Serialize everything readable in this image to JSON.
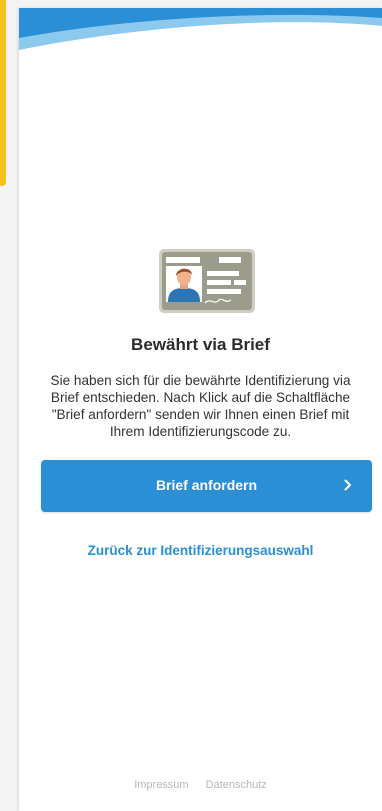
{
  "colors": {
    "accent_yellow": "#f7c21c",
    "brand_blue": "#2b8fd6",
    "background": "#f3f3f3",
    "card": "#ffffff"
  },
  "icons": {
    "header": "wave-header-graphic",
    "illustration": "id-card-icon",
    "button": "chevron-right-icon"
  },
  "main": {
    "title": "Bewährt via Brief",
    "description": "Sie haben sich für die bewährte Identifizierung via Brief entschieden. Nach Klick auf die Schaltfläche \"Brief anfordern\" senden wir Ihnen einen Brief mit Ihrem Identifizierungscode zu.",
    "primary_button": "Brief anfordern",
    "back_link": "Zurück zur Identifizierungsauswahl"
  },
  "footer": {
    "impressum": "Impressum",
    "datenschutz": "Datenschutz"
  }
}
